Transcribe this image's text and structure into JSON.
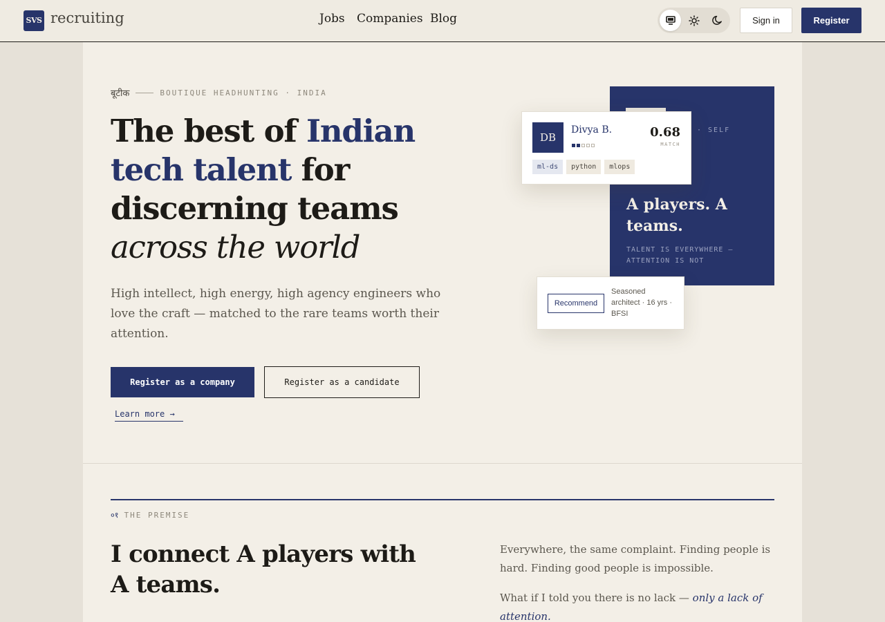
{
  "header": {
    "logo_mark": "SVS",
    "logo_word": "recruiting",
    "nav": [
      "Jobs",
      "Companies",
      "Blog"
    ],
    "theme_options": [
      {
        "icon": "monitor-icon",
        "active": true
      },
      {
        "icon": "sun-icon",
        "active": false
      },
      {
        "icon": "moon-icon",
        "active": false
      }
    ],
    "signin_label": "Sign in",
    "register_label": "Register"
  },
  "hero": {
    "eyebrow_hindi": "बूटीक",
    "eyebrow_text": "BOUTIQUE HEADHUNTING · INDIA",
    "title_1": "The best of ",
    "title_accent": "Indian tech talent",
    "title_2": " for discerning teams",
    "title_italic": "across the world",
    "subtitle": "High intellect, high energy, high agency engineers who love the craft — matched to the rare teams worth their attention.",
    "cta_company": "Register as a company",
    "cta_candidate": "Register as a candidate",
    "learn_more": "Learn more →"
  },
  "illustration": {
    "navy_label": "· SELF",
    "navy_headline": "A players. A teams.",
    "navy_tagline": "TALENT IS EVERYWHERE — ATTENTION IS NOT",
    "candidate": {
      "initials": "DB",
      "name": "Divya B.",
      "rating_filled": 2,
      "rating_total": 5,
      "score": "0.68",
      "score_label": "MATCH",
      "tags": [
        "ml-ds",
        "python",
        "mlops"
      ]
    },
    "recommend": {
      "button": "Recommend",
      "text": "Seasoned architect · 16 yrs · BFSI"
    }
  },
  "premise": {
    "number": "०१",
    "label": "THE PREMISE",
    "title": "I connect A players with A teams.",
    "paragraph_1": "Everywhere, the same complaint. Finding people is hard. Finding good people is impossible.",
    "paragraph_2_plain": "What if I told you there is no lack — ",
    "paragraph_2_emphasis": "only a lack of attention."
  },
  "colors": {
    "navy": "#27346a",
    "cream": "#f3efe7",
    "ink": "#1d1b17"
  }
}
